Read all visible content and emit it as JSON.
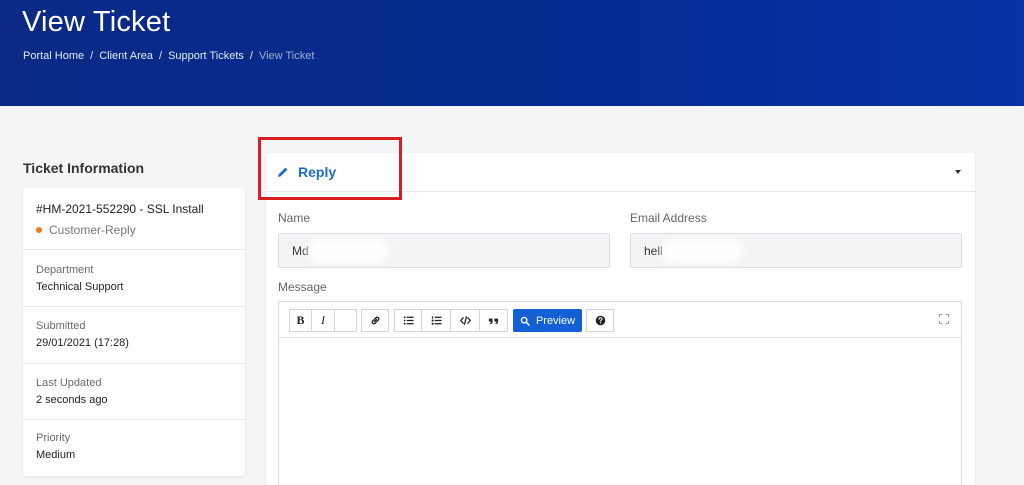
{
  "header": {
    "title": "View Ticket",
    "breadcrumbs": [
      "Portal Home",
      "Client Area",
      "Support Tickets"
    ],
    "breadcrumb_current": "View Ticket",
    "separator": "/"
  },
  "sidebar": {
    "title": "Ticket Information",
    "ticket_id": "#HM-2021-552290 - SSL Install",
    "status": "Customer-Reply",
    "status_color": "#f07a12",
    "department_label": "Department",
    "department_value": "Technical Support",
    "submitted_label": "Submitted",
    "submitted_value": "29/01/2021 (17:28)",
    "updated_label": "Last Updated",
    "updated_value": "2 seconds ago",
    "priority_label": "Priority",
    "priority_value": "Medium"
  },
  "reply": {
    "title": "Reply",
    "icon": "pencil-icon",
    "name_label": "Name",
    "name_value": "Md",
    "email_label": "Email Address",
    "email_value": "hell",
    "message_label": "Message",
    "toolbar": {
      "bold": "B",
      "italic": "I",
      "preview": "Preview"
    },
    "accent_color": "#1160d6",
    "highlight_color": "#d81e1e"
  }
}
